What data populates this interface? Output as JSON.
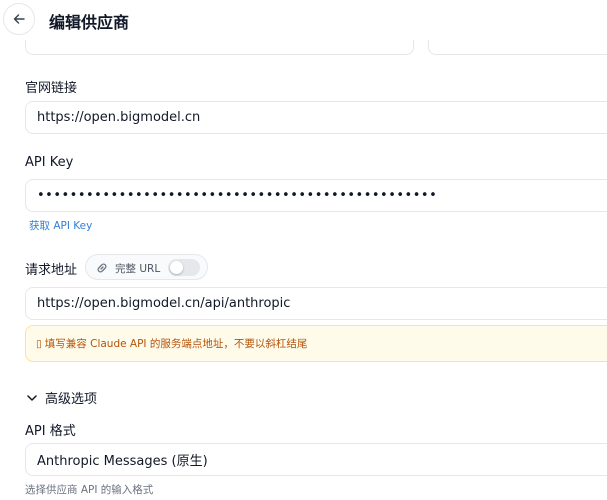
{
  "header": {
    "title": "编辑供应商"
  },
  "fields": {
    "website": {
      "label": "官网链接",
      "value": "https://open.bigmodel.cn"
    },
    "api_key": {
      "label": "API Key",
      "value": "•••••••••••••••••••••••••••••••••••••••••••••••••",
      "get_key_link": "获取 API Key"
    },
    "endpoint": {
      "label": "请求地址",
      "full_url_label": "完整 URL",
      "full_url_enabled": false,
      "value": "https://open.bigmodel.cn/api/anthropic",
      "warning_icon": "warning-icon",
      "warning": "填写兼容 Claude API 的服务端点地址，不要以斜杠结尾"
    }
  },
  "advanced": {
    "toggle_label": "高级选项",
    "expanded": true,
    "api_format": {
      "label": "API 格式",
      "value": "Anthropic Messages (原生)",
      "hint": "选择供应商 API 的输入格式"
    }
  },
  "colors": {
    "link": "#2f7fd8",
    "warning_text": "#b45309",
    "warning_bg": "#fffbeb",
    "warning_border": "#fde68a"
  }
}
